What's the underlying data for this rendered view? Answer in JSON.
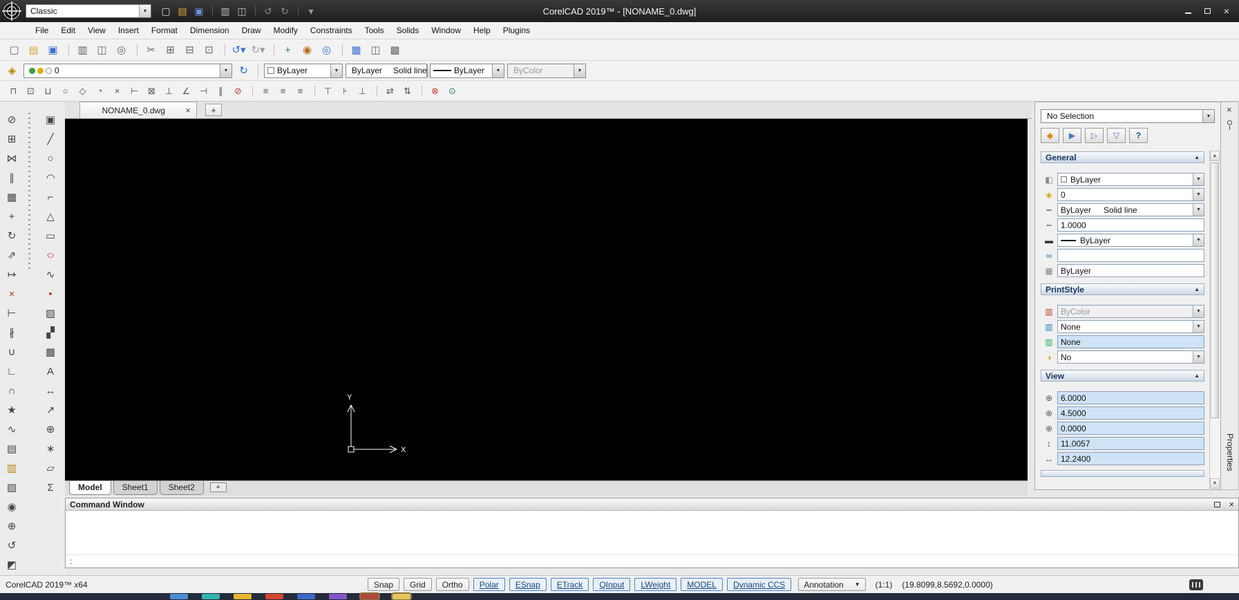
{
  "ui": {
    "dropdown": "▼",
    "collapse": "▲",
    "scroll_up": "▲",
    "scroll_down": "▼"
  },
  "titlebar": {
    "workspace": "Classic",
    "title": "CorelCAD 2019™ - [NONAME_0.dwg]",
    "close": "×",
    "tools": [
      {
        "name": "new-icon",
        "glyph": "▢",
        "color": "#d8d8d8"
      },
      {
        "name": "open-icon",
        "glyph": "▤",
        "color": "#e0a83c"
      },
      {
        "name": "save-icon",
        "glyph": "▣",
        "color": "#6a94dd"
      },
      {
        "name": "print-icon",
        "glyph": "▥",
        "color": "#bdbdbd",
        "cls": "gap"
      },
      {
        "name": "print-preview-icon",
        "glyph": "◫",
        "color": "#bdbdbd"
      },
      {
        "name": "undo-icon",
        "glyph": "↺",
        "color": "#8a8a8a",
        "cls": "gap"
      },
      {
        "name": "redo-icon",
        "glyph": "↻",
        "color": "#8a8a8a"
      },
      {
        "name": "customize-toolbar-icon",
        "glyph": "▾",
        "color": "#9a9a9a",
        "cls": "gap"
      }
    ]
  },
  "menubar": [
    {
      "name": "menu-file",
      "label": "File"
    },
    {
      "name": "menu-edit",
      "label": "Edit"
    },
    {
      "name": "menu-view",
      "label": "View"
    },
    {
      "name": "menu-insert",
      "label": "Insert"
    },
    {
      "name": "menu-format",
      "label": "Format"
    },
    {
      "name": "menu-dimension",
      "label": "Dimension"
    },
    {
      "name": "menu-draw",
      "label": "Draw"
    },
    {
      "name": "menu-modify",
      "label": "Modify"
    },
    {
      "name": "menu-constraints",
      "label": "Constraints"
    },
    {
      "name": "menu-tools",
      "label": "Tools"
    },
    {
      "name": "menu-solids",
      "label": "Solids"
    },
    {
      "name": "menu-window",
      "label": "Window"
    },
    {
      "name": "menu-help",
      "label": "Help"
    },
    {
      "name": "menu-plugins",
      "label": "Plugins"
    }
  ],
  "standard_toolbar": [
    {
      "name": "new-icon",
      "glyph": "▢",
      "color": "#666666"
    },
    {
      "name": "open-icon",
      "glyph": "▤",
      "color": "#d9a23c"
    },
    {
      "name": "save-icon",
      "glyph": "▣",
      "color": "#3b6fd4"
    },
    {
      "name": "print-icon",
      "glyph": "▥",
      "color": "#666666",
      "cls": "gap"
    },
    {
      "name": "print-preview-icon",
      "glyph": "◫",
      "color": "#666666"
    },
    {
      "name": "find-icon",
      "glyph": "◎",
      "color": "#666666"
    },
    {
      "name": "cut-icon",
      "glyph": "✂",
      "color": "#666666",
      "cls": "gap"
    },
    {
      "name": "copy-icon",
      "glyph": "⊞",
      "color": "#666666"
    },
    {
      "name": "paste-icon",
      "glyph": "⊟",
      "color": "#666666"
    },
    {
      "name": "paste-special-icon",
      "glyph": "⊡",
      "color": "#666666"
    },
    {
      "name": "undo-icon",
      "glyph": "↺▾",
      "color": "#3b6fd4",
      "cls": "gap"
    },
    {
      "name": "redo-icon",
      "glyph": "↻▾",
      "color": "#9a9a9a"
    },
    {
      "name": "pan-icon",
      "glyph": "+",
      "color": "#2e8b57",
      "cls": "gap"
    },
    {
      "name": "zoom-dynamic-icon",
      "glyph": "◉",
      "color": "#b86a14"
    },
    {
      "name": "zoom-window-icon",
      "glyph": "◎",
      "color": "#3b6fd4"
    },
    {
      "name": "grid-settings-icon",
      "glyph": "▦",
      "color": "#3b6fd4",
      "cls": "gap"
    },
    {
      "name": "tile-windows-icon",
      "glyph": "◫",
      "color": "#666666"
    },
    {
      "name": "options-icon",
      "glyph": "▩",
      "color": "#666666"
    }
  ],
  "format_icons": {
    "layers_manager": "◈",
    "refresh": "↻"
  },
  "format_toolbar": {
    "layer": "0",
    "color": "ByLayer",
    "linetype_name": "ByLayer",
    "linetype_desc": "Solid line",
    "lineweight": "ByLayer",
    "print_style": "ByColor"
  },
  "snap_toolbar": [
    {
      "name": "esnap-settings-icon",
      "glyph": "⊓",
      "color": "#555555"
    },
    {
      "name": "esnap-endpoint-icon",
      "glyph": "⊡",
      "color": "#555555"
    },
    {
      "name": "esnap-midpoint-icon",
      "glyph": "⊔",
      "color": "#555555"
    },
    {
      "name": "esnap-center-icon",
      "glyph": "○",
      "color": "#555555"
    },
    {
      "name": "esnap-node-icon",
      "glyph": "◇",
      "color": "#555555"
    },
    {
      "name": "esnap-quadrant-icon",
      "glyph": "◔",
      "color": "#555555"
    },
    {
      "name": "esnap-intersection-icon",
      "glyph": "×",
      "color": "#555555"
    },
    {
      "name": "esnap-extension-icon",
      "glyph": "⊢",
      "color": "#555555"
    },
    {
      "name": "esnap-insertion-icon",
      "glyph": "⊠",
      "color": "#555555"
    },
    {
      "name": "esnap-perpendicular-icon",
      "glyph": "⊥",
      "color": "#555555"
    },
    {
      "name": "esnap-tangent-icon",
      "glyph": "∠",
      "color": "#555555"
    },
    {
      "name": "esnap-nearest-icon",
      "glyph": "⊣",
      "color": "#555555"
    },
    {
      "name": "esnap-parallel-icon",
      "glyph": "∥",
      "color": "#555555"
    },
    {
      "name": "esnap-off-icon",
      "glyph": "⊘",
      "color": "#c0392b"
    },
    {
      "name": "align-left-icon",
      "glyph": "≡",
      "color": "#555555",
      "cls": "gap"
    },
    {
      "name": "align-center-icon",
      "glyph": "≡",
      "color": "#555555"
    },
    {
      "name": "align-right-icon",
      "glyph": "≡",
      "color": "#555555"
    },
    {
      "name": "align-top-icon",
      "glyph": "⊤",
      "color": "#555555",
      "cls": "gap"
    },
    {
      "name": "align-middle-icon",
      "glyph": "⊦",
      "color": "#555555"
    },
    {
      "name": "align-bottom-icon",
      "glyph": "⊥",
      "color": "#555555"
    },
    {
      "name": "distribute-horizontal-icon",
      "glyph": "⇄",
      "color": "#555555",
      "cls": "gap"
    },
    {
      "name": "distribute-vertical-icon",
      "glyph": "⇅",
      "color": "#555555"
    },
    {
      "name": "constraint-delete-icon",
      "glyph": "⊗",
      "color": "#c0392b",
      "cls": "gap"
    },
    {
      "name": "constraint-show-icon",
      "glyph": "⊙",
      "color": "#2e8b57"
    }
  ],
  "modify_tools": [
    {
      "name": "erase-tool-icon",
      "glyph": "⊘",
      "color": "#444444"
    },
    {
      "name": "copy-tool-icon",
      "glyph": "⊞",
      "color": "#444444"
    },
    {
      "name": "mirror-tool-icon",
      "glyph": "⋈",
      "color": "#444444"
    },
    {
      "name": "offset-tool-icon",
      "glyph": "∥",
      "color": "#444444"
    },
    {
      "name": "pattern-tool-icon",
      "glyph": "▦",
      "color": "#444444"
    },
    {
      "name": "move-tool-icon",
      "glyph": "+",
      "color": "#444444"
    },
    {
      "name": "rotate-tool-icon",
      "glyph": "↻",
      "color": "#444444"
    },
    {
      "name": "scale-tool-icon",
      "glyph": "⇗",
      "color": "#444444"
    },
    {
      "name": "stretch-tool-icon",
      "glyph": "↦",
      "color": "#444444"
    },
    {
      "name": "trim-tool-icon",
      "glyph": "×",
      "color": "#c0392b"
    },
    {
      "name": "extend-tool-icon",
      "glyph": "⊢",
      "color": "#444444"
    },
    {
      "name": "split-tool-icon",
      "glyph": "∦",
      "color": "#444444"
    },
    {
      "name": "weld-tool-icon",
      "glyph": "∪",
      "color": "#444444"
    },
    {
      "name": "chamfer-tool-icon",
      "glyph": "∟",
      "color": "#444444"
    },
    {
      "name": "fillet-tool-icon",
      "glyph": "∩",
      "color": "#444444"
    },
    {
      "name": "explode-tool-icon",
      "glyph": "★",
      "color": "#444444"
    },
    {
      "name": "edit-polyline-tool-icon",
      "glyph": "∿",
      "color": "#444444"
    },
    {
      "name": "entity-properties-tool-icon",
      "glyph": "▤",
      "color": "#444444"
    },
    {
      "name": "match-properties-tool-icon",
      "glyph": "▥",
      "color": "#b8860b"
    },
    {
      "name": "hatch-edit-tool-icon",
      "glyph": "▨",
      "color": "#444444"
    },
    {
      "name": "zoom-tool-icon",
      "glyph": "◉",
      "color": "#444444"
    },
    {
      "name": "pan-tool-icon",
      "glyph": "⊕",
      "color": "#444444"
    },
    {
      "name": "regenerate-tool-icon",
      "glyph": "↺",
      "color": "#444444"
    },
    {
      "name": "clean-screen-tool-icon",
      "glyph": "◩",
      "color": "#444444"
    }
  ],
  "draw_tools": [
    {
      "name": "insert-block-tool-icon",
      "glyph": "▣",
      "color": "#444444"
    },
    {
      "name": "line-tool-icon",
      "glyph": "╱",
      "color": "#444444"
    },
    {
      "name": "circle-tool-icon",
      "glyph": "○",
      "color": "#444444"
    },
    {
      "name": "arc-tool-icon",
      "glyph": "◠",
      "color": "#444444"
    },
    {
      "name": "polyline-tool-icon",
      "glyph": "⌐",
      "color": "#444444"
    },
    {
      "name": "polygon-tool-icon",
      "glyph": "△",
      "color": "#444444"
    },
    {
      "name": "rectangle-tool-icon",
      "glyph": "▭",
      "color": "#444444"
    },
    {
      "name": "ellipse-tool-icon",
      "glyph": "○",
      "color": "#c0392b",
      "cls": "wide"
    },
    {
      "name": "spline-tool-icon",
      "glyph": "∿",
      "color": "#444444"
    },
    {
      "name": "point-tool-icon",
      "glyph": "•",
      "color": "#c0392b"
    },
    {
      "name": "hatch-tool-icon",
      "glyph": "▨",
      "color": "#444444"
    },
    {
      "name": "region-tool-icon",
      "glyph": "▞",
      "color": "#444444"
    },
    {
      "name": "table-tool-icon",
      "glyph": "▦",
      "color": "#444444"
    },
    {
      "name": "text-tool-icon",
      "glyph": "A",
      "color": "#444444"
    },
    {
      "name": "dimension-tool-icon",
      "glyph": "↔",
      "color": "#444444"
    },
    {
      "name": "leader-tool-icon",
      "glyph": "↗",
      "color": "#444444"
    },
    {
      "name": "tolerance-tool-icon",
      "glyph": "⊕",
      "color": "#444444"
    },
    {
      "name": "center-mark-tool-icon",
      "glyph": "∗",
      "color": "#444444"
    },
    {
      "name": "area-tool-icon",
      "glyph": "▱",
      "color": "#444444"
    },
    {
      "name": "mass-properties-tool-icon",
      "glyph": "Σ",
      "color": "#444444"
    }
  ],
  "document": {
    "tab": "NONAME_0.dwg",
    "close": "×",
    "add": "+"
  },
  "canvas": {
    "x_label": "X",
    "y_label": "Y"
  },
  "sheets": {
    "tabs": [
      {
        "name": "sheet-tab-model",
        "label": "Model",
        "cls": "active"
      },
      {
        "name": "sheet-tab-sheet1",
        "label": "Sheet1"
      },
      {
        "name": "sheet-tab-sheet2",
        "label": "Sheet2"
      }
    ],
    "add": "+"
  },
  "prop_icons": {
    "color": "◧",
    "layer": "◈",
    "linetype": "┅",
    "linetype_scale": "┉",
    "lineweight": "▬",
    "hyperlink": "∞",
    "plot_style": "▦",
    "print_style": "▥",
    "print_table": "▥",
    "print_attached": "▥",
    "print_type": "◑",
    "center_x": "⊕",
    "center_y": "⊕",
    "center_z": "⊕",
    "height": "↕",
    "width": "↔"
  },
  "properties": {
    "panel_title": "Properties",
    "selection": "No Selection",
    "close": "×",
    "toolbar": [
      {
        "name": "selection-settings-icon",
        "glyph": "◆",
        "color": "#d98a1f"
      },
      {
        "name": "select-entities-icon",
        "glyph": "▶",
        "color": "#4a78c4"
      },
      {
        "name": "quick-select-icon",
        "glyph": "▷",
        "color": "#4a78c4"
      },
      {
        "name": "clear-selection-icon",
        "glyph": "▽",
        "color": "#4a78c4"
      },
      {
        "name": "help-icon",
        "glyph": "?",
        "color": "#1f4e79"
      }
    ],
    "general": {
      "label": "General",
      "color": "ByLayer",
      "layer": "0",
      "linetype_name": "ByLayer",
      "linetype_desc": "Solid line",
      "linetype_scale": "1.0000",
      "lineweight": "ByLayer",
      "hyperlink": "",
      "plot_style": "ByLayer"
    },
    "printstyle": {
      "label": "PrintStyle",
      "print_style": "ByColor",
      "print_style_table": "None",
      "print_table_attached": "None",
      "print_table_type": "No"
    },
    "view": {
      "label": "View",
      "center_x": "6.0000",
      "center_y": "4.5000",
      "center_z": "0.0000",
      "height": "11.0057",
      "width": "12.2400"
    }
  },
  "command": {
    "title": "Command Window",
    "prompt": ":",
    "close": "×"
  },
  "statusbar": {
    "app": "CorelCAD 2019™ x64",
    "toggles": [
      {
        "name": "snap-toggle",
        "label": "Snap"
      },
      {
        "name": "grid-toggle",
        "label": "Grid"
      },
      {
        "name": "ortho-toggle",
        "label": "Ortho"
      },
      {
        "name": "polar-toggle",
        "label": "Polar",
        "cls": "on"
      },
      {
        "name": "esnap-toggle",
        "label": "ESnap",
        "cls": "on"
      },
      {
        "name": "etrack-toggle",
        "label": "ETrack",
        "cls": "on"
      },
      {
        "name": "qinput-toggle",
        "label": "QInput",
        "cls": "on"
      },
      {
        "name": "lweight-toggle",
        "label": "LWeight",
        "cls": "on"
      },
      {
        "name": "model-toggle",
        "label": "MODEL",
        "cls": "on"
      },
      {
        "name": "dynamic-ccs-toggle",
        "label": "Dynamic CCS",
        "cls": "on"
      }
    ],
    "annotation": "Annotation",
    "scale": "(1:1)",
    "coordinates": "(19.8099,8.5692,0.0000)"
  },
  "taskbar": {
    "icons": [
      {
        "bg": "#4a8fd4"
      },
      {
        "bg": "#35b5ad"
      },
      {
        "bg": "#e8b431"
      },
      {
        "bg": "#d6452f"
      },
      {
        "bg": "#3f66c4"
      },
      {
        "bg": "#8455c8"
      },
      {
        "bg": "#b2483a",
        "cls": "slot"
      },
      {
        "bg": "#e3c75a",
        "cls": "slot"
      }
    ]
  }
}
